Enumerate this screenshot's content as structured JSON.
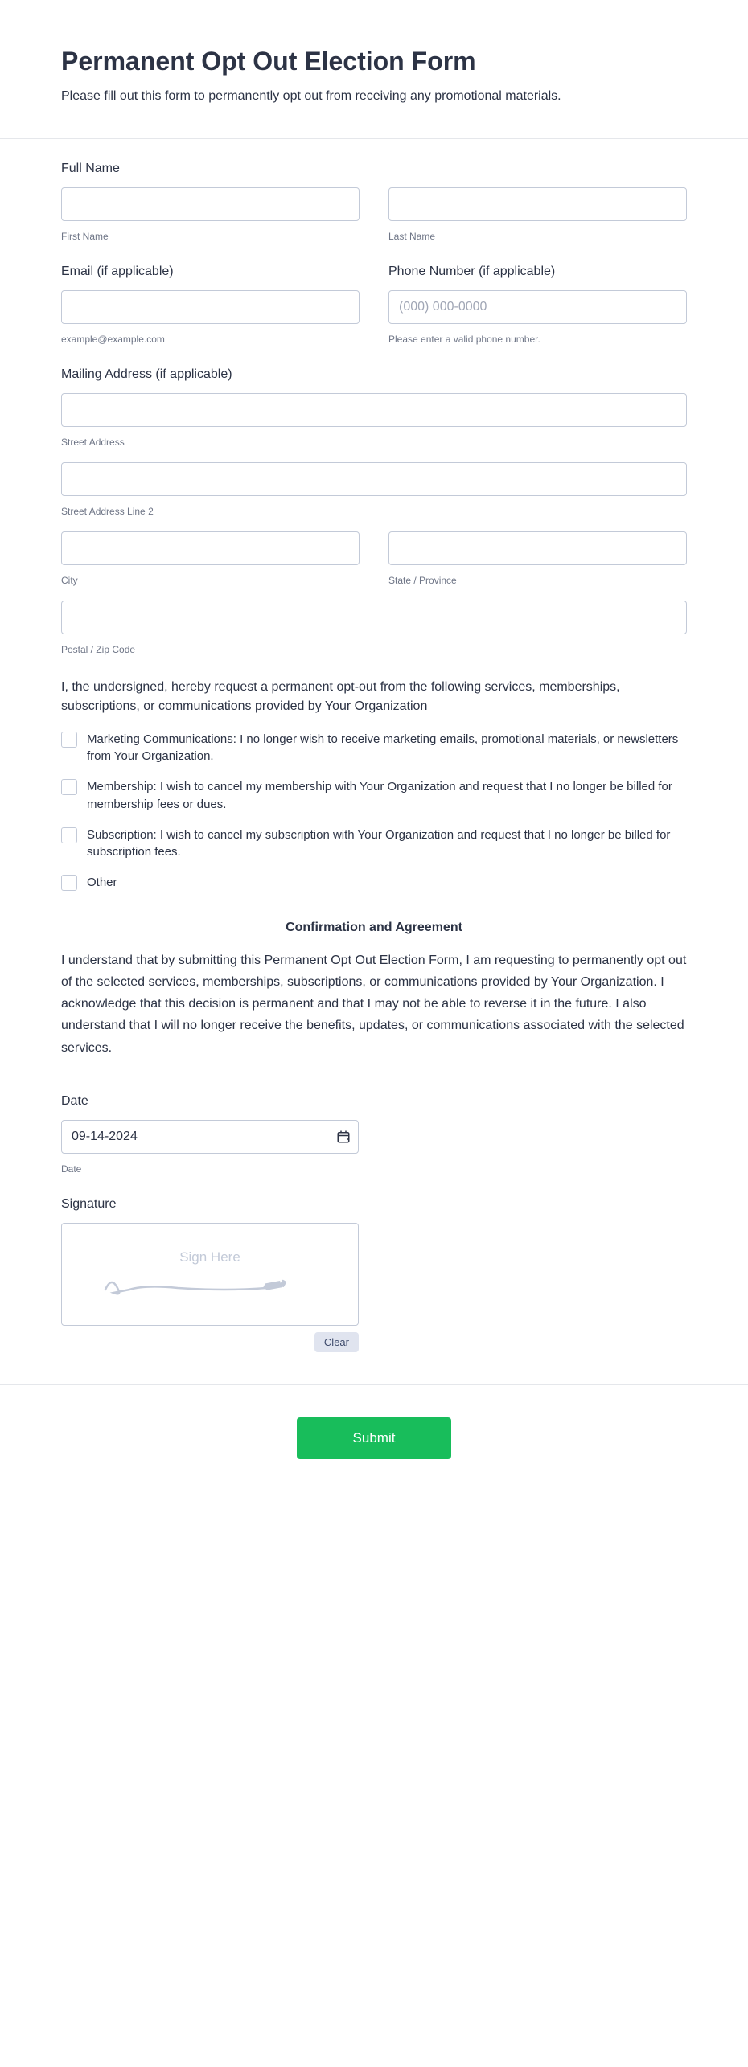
{
  "header": {
    "title": "Permanent Opt Out Election Form",
    "subtitle": "Please fill out this form to permanently opt out from receiving any promotional materials."
  },
  "fullName": {
    "label": "Full Name",
    "first_sub": "First Name",
    "last_sub": "Last Name"
  },
  "email": {
    "label": "Email (if applicable)",
    "sub": "example@example.com"
  },
  "phone": {
    "label": "Phone Number (if applicable)",
    "placeholder": "(000) 000-0000",
    "sub": "Please enter a valid phone number."
  },
  "address": {
    "label": "Mailing Address (if applicable)",
    "street": "Street Address",
    "street2": "Street Address Line 2",
    "city": "City",
    "state": "State / Province",
    "postal": "Postal / Zip Code"
  },
  "statement": "I, the undersigned, hereby request a permanent opt-out from the following services, memberships, subscriptions, or communications provided by Your Organization",
  "options": {
    "marketing": "Marketing Communications: I no longer wish to receive marketing emails, promotional materials, or newsletters from Your Organization.",
    "membership": "Membership: I wish to cancel my membership with Your Organization and request that I no longer be billed for membership fees or dues.",
    "subscription": "Subscription: I wish to cancel my subscription with Your Organization and request that I no longer be billed for subscription fees.",
    "other": "Other"
  },
  "confirmation": {
    "title": "Confirmation and Agreement",
    "text": "I understand that by submitting this Permanent Opt Out Election Form, I am requesting to permanently opt out of the selected services, memberships, subscriptions, or communications provided by Your Organization. I acknowledge that this decision is permanent and that I may not be able to reverse it in the future. I also understand that I will no longer receive the benefits, updates, or communications associated with the selected services."
  },
  "date": {
    "label": "Date",
    "value": "09-14-2024",
    "sub": "Date"
  },
  "signature": {
    "label": "Signature",
    "placeholder": "Sign Here",
    "clear": "Clear"
  },
  "submit": "Submit"
}
